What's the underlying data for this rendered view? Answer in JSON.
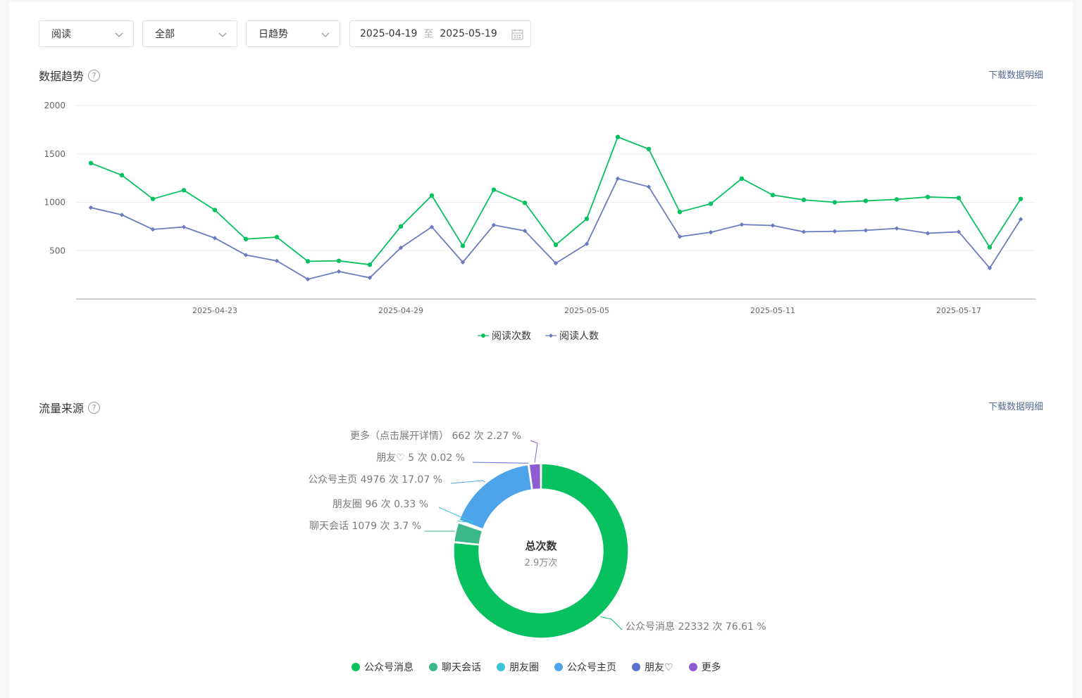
{
  "filters": {
    "metric_select": "阅读",
    "scope_select": "全部",
    "trend_select": "日趋势",
    "date_start": "2025-04-19",
    "date_separator": "至",
    "date_end": "2025-05-19"
  },
  "trend_section": {
    "title": "数据趋势",
    "help_icon": "?",
    "download_label": "下载数据明细"
  },
  "source_section": {
    "title": "流量来源",
    "help_icon": "?",
    "download_label": "下载数据明细",
    "center_title": "总次数",
    "center_value": "2.9万次"
  },
  "chart_data": [
    {
      "type": "line",
      "x": [
        "2025-04-19",
        "2025-04-20",
        "2025-04-21",
        "2025-04-22",
        "2025-04-23",
        "2025-04-24",
        "2025-04-25",
        "2025-04-26",
        "2025-04-27",
        "2025-04-28",
        "2025-04-29",
        "2025-04-30",
        "2025-05-01",
        "2025-05-02",
        "2025-05-03",
        "2025-05-04",
        "2025-05-05",
        "2025-05-06",
        "2025-05-07",
        "2025-05-08",
        "2025-05-09",
        "2025-05-10",
        "2025-05-11",
        "2025-05-12",
        "2025-05-13",
        "2025-05-14",
        "2025-05-15",
        "2025-05-16",
        "2025-05-17",
        "2025-05-18",
        "2025-05-19"
      ],
      "x_tick_labels": [
        "2025-04-23",
        "2025-04-29",
        "2025-05-05",
        "2025-05-11",
        "2025-05-17"
      ],
      "y_ticks": [
        500,
        1000,
        1500,
        2000
      ],
      "ylim": [
        0,
        2000
      ],
      "grid": true,
      "legend_position": "bottom",
      "series": [
        {
          "name": "阅读次数",
          "color": "#07c160",
          "marker": "circle",
          "values": [
            1405,
            1280,
            1035,
            1125,
            920,
            620,
            640,
            390,
            395,
            355,
            750,
            1070,
            550,
            1130,
            995,
            560,
            830,
            1675,
            1550,
            900,
            985,
            1245,
            1075,
            1025,
            1000,
            1015,
            1030,
            1055,
            1045,
            535,
            1035
          ]
        },
        {
          "name": "阅读人数",
          "color": "#6b7bbf",
          "marker": "diamond",
          "values": [
            945,
            870,
            720,
            745,
            630,
            455,
            395,
            205,
            285,
            220,
            530,
            745,
            380,
            765,
            705,
            370,
            570,
            1245,
            1160,
            645,
            690,
            770,
            760,
            695,
            700,
            710,
            730,
            680,
            695,
            320,
            825
          ]
        }
      ]
    },
    {
      "type": "pie",
      "style": "donut",
      "legend_position": "bottom",
      "slices": [
        {
          "name": "公众号消息",
          "value": 22332,
          "percent": 76.61,
          "unit": "次",
          "color": "#07c160"
        },
        {
          "name": "聊天会话",
          "value": 1079,
          "percent": 3.7,
          "unit": "次",
          "color": "#3bb88a"
        },
        {
          "name": "朋友圈",
          "value": 96,
          "percent": 0.33,
          "unit": "次",
          "color": "#3cc6dc"
        },
        {
          "name": "公众号主页",
          "value": 4976,
          "percent": 17.07,
          "unit": "次",
          "color": "#4ea4ea"
        },
        {
          "name": "朋友♡",
          "value": 5,
          "percent": 0.02,
          "unit": "次",
          "color": "#5b6fcc"
        },
        {
          "name": "更多（点击展开详情）",
          "legend_name": "更多",
          "value": 662,
          "percent": 2.27,
          "unit": "次",
          "color": "#8e5bd1"
        }
      ],
      "slice_labels": [
        "公众号消息 22332 次 76.61 %",
        "聊天会话 1079 次 3.7 %",
        "朋友圈 96 次 0.33 %",
        "公众号主页 4976 次 17.07 %",
        "朋友♡ 5 次 0.02 %",
        "更多（点击展开详情） 662 次 2.27 %"
      ]
    }
  ]
}
